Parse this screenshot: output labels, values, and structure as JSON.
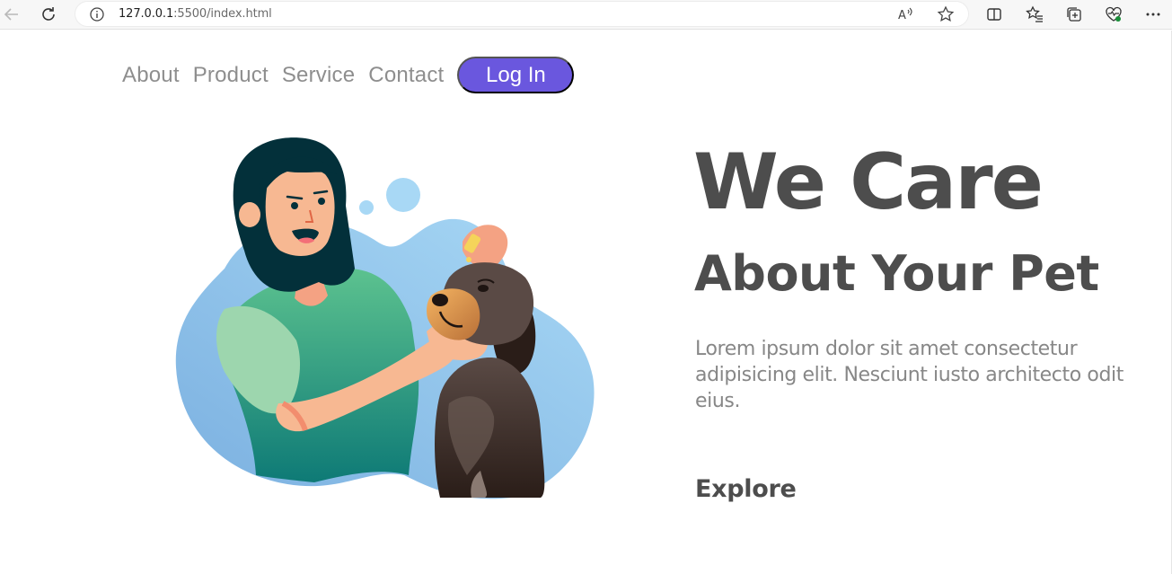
{
  "browser": {
    "url_host": "127.0.0.1",
    "url_rest": ":5500/index.html"
  },
  "nav": {
    "links": [
      "About",
      "Product",
      "Service",
      "Contact"
    ],
    "login_label": "Log In"
  },
  "hero": {
    "title": "We Care",
    "subtitle": "About Your Pet",
    "text": "Lorem ipsum dolor sit amet consectetur adipisicing elit. Nesciunt iusto architecto odit eius.",
    "explore_label": "Explore"
  },
  "colors": {
    "accent": "#6a57de",
    "heading": "#4d4d4d",
    "muted": "#8e8e8e",
    "blob": "#8cc6ee"
  }
}
